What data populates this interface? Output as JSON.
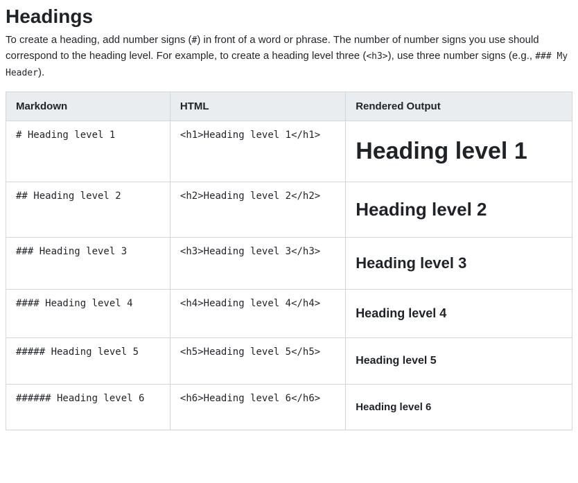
{
  "title": "Headings",
  "description": {
    "part1": "To create a heading, add number signs (",
    "code1": "#",
    "part2": ") in front of a word or phrase. The number of number signs you use should correspond to the heading level. For example, to create a heading level three (",
    "code2": "<h3>",
    "part3": "), use three number signs (e.g., ",
    "code3": "### My Header",
    "part4": ")."
  },
  "table": {
    "headers": {
      "markdown": "Markdown",
      "html": "HTML",
      "rendered": "Rendered Output"
    },
    "rows": [
      {
        "markdown": "# Heading level 1",
        "html": "<h1>Heading level 1</h1>",
        "rendered": "Heading level 1"
      },
      {
        "markdown": "## Heading level 2",
        "html": "<h2>Heading level 2</h2>",
        "rendered": "Heading level 2"
      },
      {
        "markdown": "### Heading level 3",
        "html": "<h3>Heading level 3</h3>",
        "rendered": "Heading level 3"
      },
      {
        "markdown": "#### Heading level 4",
        "html": "<h4>Heading level 4</h4>",
        "rendered": "Heading level 4"
      },
      {
        "markdown": "##### Heading level 5",
        "html": "<h5>Heading level 5</h5>",
        "rendered": "Heading level 5"
      },
      {
        "markdown": "###### Heading level 6",
        "html": "<h6>Heading level 6</h6>",
        "rendered": "Heading level 6"
      }
    ]
  }
}
